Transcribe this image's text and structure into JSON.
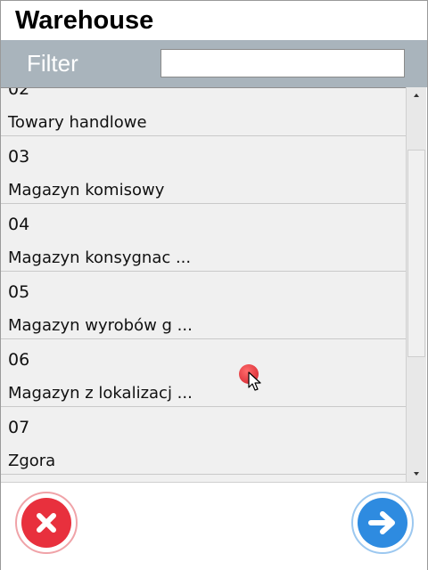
{
  "window": {
    "title": "Warehouse"
  },
  "filter": {
    "label": "Filter",
    "value": "",
    "placeholder": ""
  },
  "warehouses": [
    {
      "code": "02",
      "name": "Towary handlowe"
    },
    {
      "code": "03",
      "name": "Magazyn komisowy"
    },
    {
      "code": "04",
      "name": "Magazyn konsygnac ..."
    },
    {
      "code": "05",
      "name": "Magazyn wyrobów g ..."
    },
    {
      "code": "06",
      "name": "Magazyn z lokalizacj ..."
    },
    {
      "code": "07",
      "name": "Zgora"
    }
  ],
  "actions": {
    "cancel_icon": "close-icon",
    "next_icon": "arrow-right-icon"
  },
  "colors": {
    "filter_bar": "#a9b4bc",
    "cancel": "#e8303d",
    "next": "#2e8be0"
  }
}
